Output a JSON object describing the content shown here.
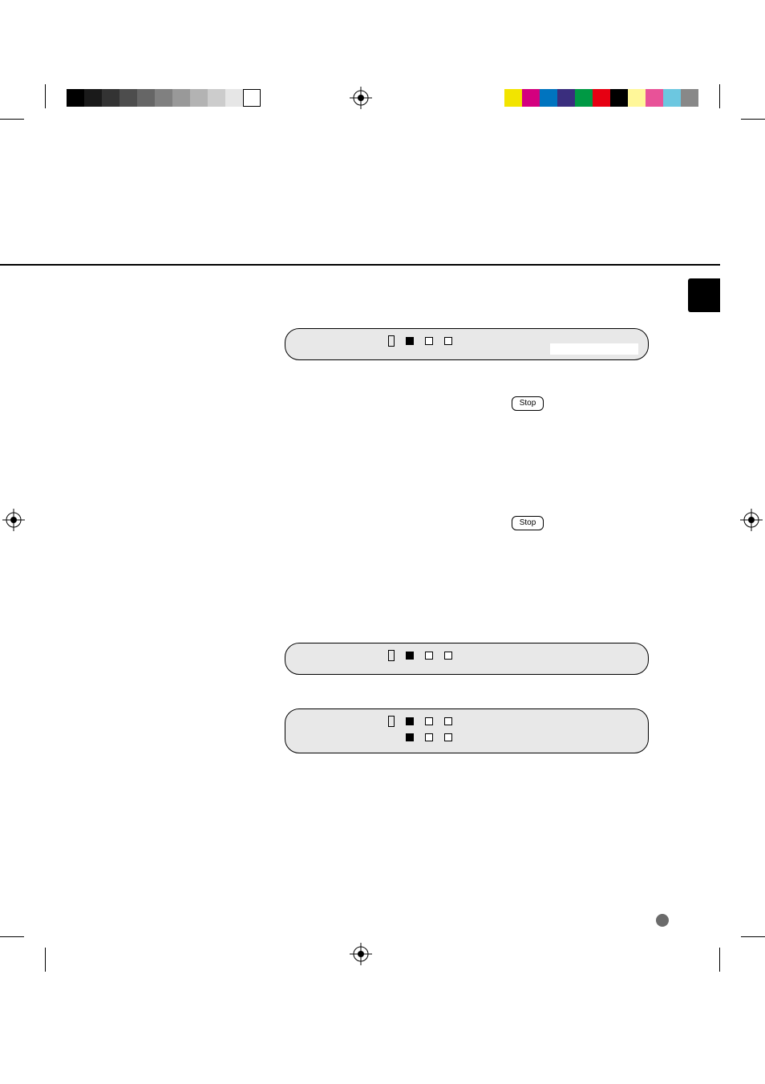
{
  "gray_swatches": [
    "#000000",
    "#1a1a1a",
    "#333333",
    "#4d4d4d",
    "#666666",
    "#808080",
    "#999999",
    "#b3b3b3",
    "#cccccc",
    "#e6e6e6",
    "#ffffff"
  ],
  "color_swatches": [
    "#f2e400",
    "#d4007f",
    "#0074bf",
    "#3a2e7e",
    "#009944",
    "#e60012",
    "#000000",
    "#fff799",
    "#e85298",
    "#6cc7e0",
    "#888888"
  ],
  "buttons": {
    "stop_label": "Stop"
  },
  "panels": {
    "p1": {
      "icons": [
        "tape",
        "filled",
        "open",
        "open"
      ],
      "has_sublabel_box": true
    },
    "p2": {
      "icons": [
        "tape",
        "filled",
        "open",
        "open"
      ]
    },
    "p3": {
      "icons_row1": [
        "tape",
        "filled",
        "open",
        "open"
      ],
      "icons_row2": [
        "filled",
        "open",
        "open"
      ]
    }
  }
}
